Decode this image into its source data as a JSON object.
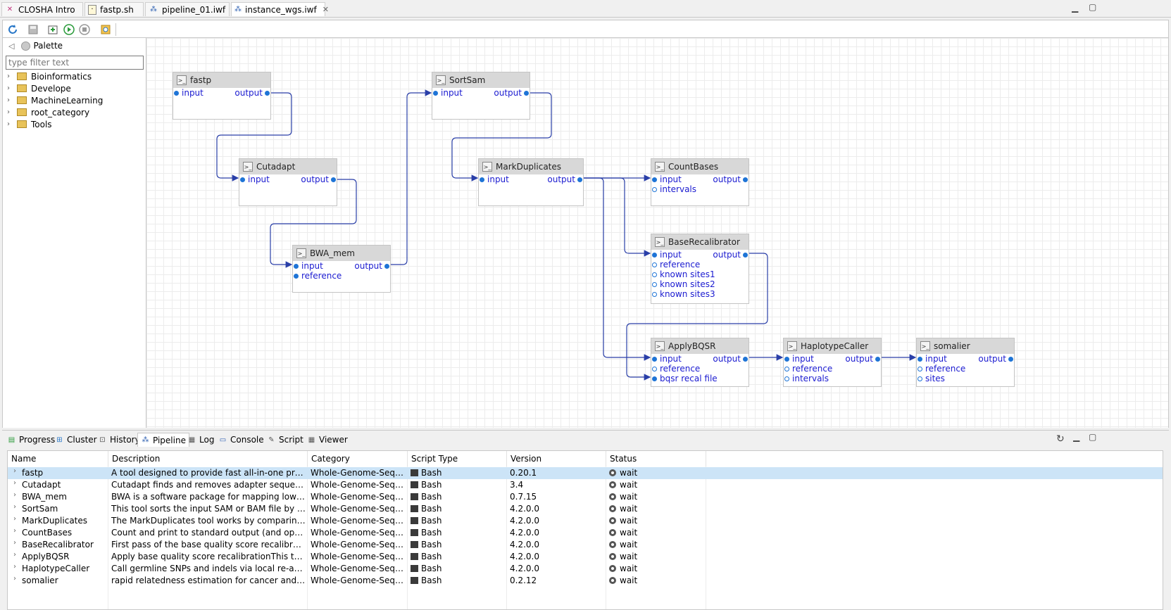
{
  "editor_tabs": [
    {
      "label": "CLOSHA Intro",
      "icon": "closha-logo-icon"
    },
    {
      "label": "fastp.sh",
      "icon": "script-file-icon"
    },
    {
      "label": "pipeline_01.iwf",
      "icon": "workflow-file-icon"
    },
    {
      "label": "instance_wgs.iwf",
      "icon": "workflow-file-icon",
      "active": true,
      "close": "✕"
    }
  ],
  "toolbar": {
    "buttons": [
      "refresh-icon",
      "save-icon",
      "export-icon",
      "run-icon",
      "stop-icon",
      "settings-icon"
    ]
  },
  "palette": {
    "title": "Palette",
    "filter_placeholder": "type filter text",
    "categories": [
      "Bioinformatics",
      "Develope",
      "MachineLearning",
      "root_category",
      "Tools"
    ]
  },
  "nodes": [
    {
      "name": "fastp",
      "inputs": [
        "input"
      ],
      "outputs": [
        "output"
      ]
    },
    {
      "name": "Cutadapt",
      "inputs": [
        "input"
      ],
      "outputs": [
        "output"
      ]
    },
    {
      "name": "BWA_mem",
      "inputs": [
        "input",
        "reference"
      ],
      "outputs": [
        "output"
      ]
    },
    {
      "name": "SortSam",
      "inputs": [
        "input"
      ],
      "outputs": [
        "output"
      ]
    },
    {
      "name": "MarkDuplicates",
      "inputs": [
        "input"
      ],
      "outputs": [
        "output"
      ]
    },
    {
      "name": "CountBases",
      "inputs": [
        "input",
        "intervals"
      ],
      "outputs": [
        "output"
      ]
    },
    {
      "name": "BaseRecalibrator",
      "inputs": [
        "input",
        "reference",
        "known sites1",
        "known sites2",
        "known sites3"
      ],
      "outputs": [
        "output"
      ]
    },
    {
      "name": "ApplyBQSR",
      "inputs": [
        "input",
        "reference",
        "bqsr recal file"
      ],
      "outputs": [
        "output"
      ]
    },
    {
      "name": "HaplotypeCaller",
      "inputs": [
        "input",
        "reference",
        "intervals"
      ],
      "outputs": [
        "output"
      ]
    },
    {
      "name": "somalier",
      "inputs": [
        "input",
        "reference",
        "sites"
      ],
      "outputs": [
        "output"
      ]
    }
  ],
  "views": {
    "tabs": [
      "Progress",
      "Cluster",
      "History",
      "Pipeline",
      "Log",
      "Console",
      "Script",
      "Viewer"
    ],
    "active": "Pipeline"
  },
  "table": {
    "columns": [
      "Name",
      "Description",
      "Category",
      "Script Type",
      "Version",
      "Status"
    ],
    "rows": [
      {
        "name": "fastp",
        "description": "A tool designed to provide fast all-in-one preproces...",
        "category": "Whole-Genome-Sequen...",
        "script_type": "Bash",
        "version": "0.20.1",
        "status": "wait"
      },
      {
        "name": "Cutadapt",
        "description": "Cutadapt finds and removes adapter sequences, pri...",
        "category": "Whole-Genome-Sequen...",
        "script_type": "Bash",
        "version": "3.4",
        "status": "wait"
      },
      {
        "name": "BWA_mem",
        "description": "BWA is a software package for mapping low-diverge...",
        "category": "Whole-Genome-Sequen...",
        "script_type": "Bash",
        "version": "0.7.15",
        "status": "wait"
      },
      {
        "name": "SortSam",
        "description": "This tool sorts the input SAM or BAM file by coordi...",
        "category": "Whole-Genome-Sequen...",
        "script_type": "Bash",
        "version": "4.2.0.0",
        "status": "wait"
      },
      {
        "name": "MarkDuplicates",
        "description": "The MarkDuplicates tool works by comparing seque...",
        "category": "Whole-Genome-Sequen...",
        "script_type": "Bash",
        "version": "4.2.0.0",
        "status": "wait"
      },
      {
        "name": "CountBases",
        "description": "Count and print to standard output (and optionally ...",
        "category": "Whole-Genome-Sequen...",
        "script_type": "Bash",
        "version": "4.2.0.0",
        "status": "wait"
      },
      {
        "name": "BaseRecalibrator",
        "description": "First pass of the base quality score recalibration. Gen...",
        "category": "Whole-Genome-Sequen...",
        "script_type": "Bash",
        "version": "4.2.0.0",
        "status": "wait"
      },
      {
        "name": "ApplyBQSR",
        "description": "Apply base quality score recalibrationThis tool perfo...",
        "category": "Whole-Genome-Sequen...",
        "script_type": "Bash",
        "version": "4.2.0.0",
        "status": "wait"
      },
      {
        "name": "HaplotypeCaller",
        "description": "Call germline SNPs and indels via local re-assembly ...",
        "category": "Whole-Genome-Sequen...",
        "script_type": "Bash",
        "version": "4.2.0.0",
        "status": "wait"
      },
      {
        "name": "somalier",
        "description": "rapid relatedness estimation for cancer and germline...",
        "category": "Whole-Genome-Sequen...",
        "script_type": "Bash",
        "version": "0.2.12",
        "status": "wait"
      }
    ],
    "selected_row": 0
  },
  "colors": {
    "accent": "#1e74d6",
    "wire": "#2a3fa8",
    "port_text": "#1a1ad0",
    "selection": "#cce4f7"
  }
}
